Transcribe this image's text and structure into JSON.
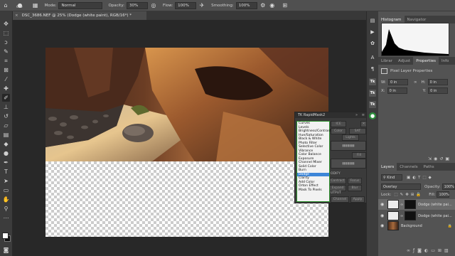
{
  "options_bar": {
    "brush_size": "600",
    "mode_label": "Mode:",
    "mode_value": "Normal",
    "opacity_label": "Opacity:",
    "opacity_value": "30%",
    "flow_label": "Flow:",
    "flow_value": "100%",
    "smoothing_label": "Smoothing:",
    "smoothing_value": "100%"
  },
  "document": {
    "tab_title": "DSC_3686.NEF @ 25% (Dodge (white paint), RGB/16*) *",
    "close": "×"
  },
  "rapidmask": {
    "title": "TK RapidMask2",
    "buttons": [
      "ICE",
      "Color",
      "SAT",
      "Lights",
      "Fill",
      "ODIFY",
      "Contract",
      "Focus",
      "Expand",
      "Blur",
      "UTPUT",
      "Channel",
      "Apply"
    ]
  },
  "context_menu": {
    "items": [
      "Curves",
      "Levels",
      "Brightness/Contrast",
      "Hue/Saturation",
      "Black & White",
      "Photo Filter",
      "Selective Color",
      "Vibrance",
      "Color Balance",
      "Exposure",
      "Channel Mixer",
      "Solid Color",
      "Burn",
      "Dodge",
      "Clarity",
      "Add Color",
      "Orton Effect",
      "Mask To Pixels"
    ],
    "selected": "Dodge"
  },
  "histogram_tabs": [
    "Histogram",
    "Navigator"
  ],
  "properties_tabs": [
    "Librar",
    "Adjust",
    "Properties",
    "Info"
  ],
  "properties": {
    "title": "Pixel Layer Properties",
    "w_label": "W:",
    "w_value": "0 in",
    "h_label": "H:",
    "h_value": "0 in",
    "x_label": "X:",
    "x_value": "0 in",
    "y_label": "Y:",
    "y_value": "0 in"
  },
  "layers_tabs": [
    "Layers",
    "Channels",
    "Paths"
  ],
  "layers_panel": {
    "kind_label": "Kind",
    "blend_mode": "Overlay",
    "opacity_label": "Opacity:",
    "opacity_value": "100%",
    "lock_label": "Lock:",
    "fill_label": "Fill:",
    "fill_value": "100%",
    "layers": [
      {
        "name": "Dodge (white pai...",
        "selected": true
      },
      {
        "name": "Dodge (white pai...",
        "selected": false
      },
      {
        "name": "Background",
        "selected": false
      }
    ]
  },
  "colors": {
    "accent_blue": "#3d86d8",
    "menu_border": "#2b8f2b",
    "ui_dark": "#282828"
  }
}
